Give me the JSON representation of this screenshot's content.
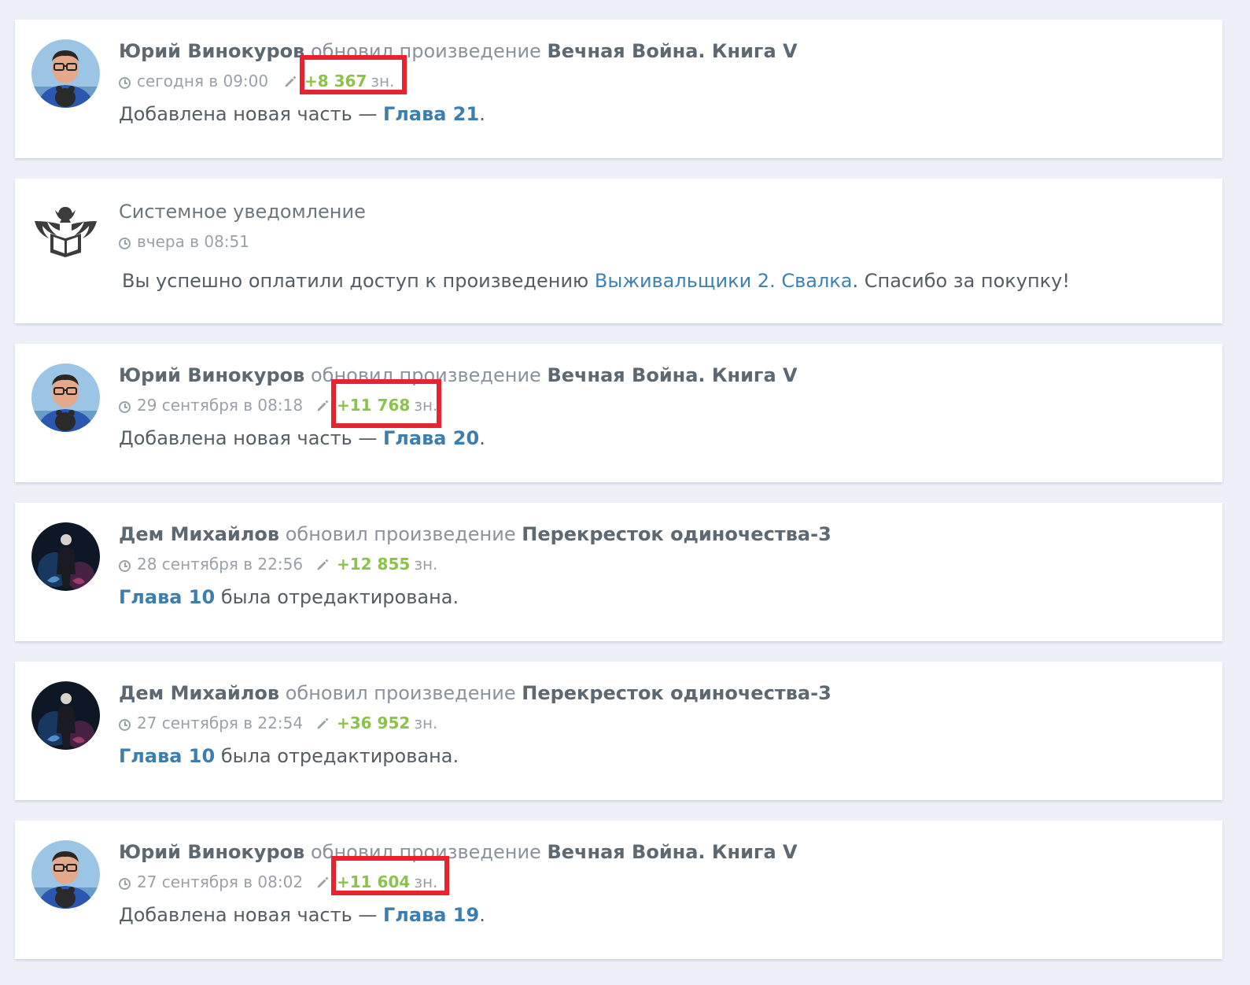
{
  "feed": {
    "items": [
      {
        "author": "Юрий Винокуров",
        "action": "обновил произведение",
        "work": "Вечная Война. Книга V",
        "time": "сегодня в 09:00",
        "count": "+8 367",
        "unit": "зн.",
        "text_before": "Добавлена новая часть —",
        "link": "Глава 21",
        "text_after": "."
      },
      {
        "title": "Системное уведомление",
        "time": "вчера в 08:51",
        "text_before": "Вы успешно оплатили доступ к произведению",
        "link": "Выживальщики 2. Свалка",
        "text_after": ". Спасибо за покупку!"
      },
      {
        "author": "Юрий Винокуров",
        "action": "обновил произведение",
        "work": "Вечная Война. Книга V",
        "time": "29 сентября в 08:18",
        "count": "+11 768",
        "unit": "зн.",
        "text_before": "Добавлена новая часть —",
        "link": "Глава 20",
        "text_after": "."
      },
      {
        "author": "Дем Михайлов",
        "action": "обновил произведение",
        "work": "Перекресток одиночества-3",
        "time": "28 сентября в 22:56",
        "count": "+12 855",
        "unit": "зн.",
        "link": "Глава 10",
        "text_after": "была отредактирована."
      },
      {
        "author": "Дем Михайлов",
        "action": "обновил произведение",
        "work": "Перекресток одиночества-3",
        "time": "27 сентября в 22:54",
        "count": "+36 952",
        "unit": "зн.",
        "link": "Глава 10",
        "text_after": "была отредактирована."
      },
      {
        "author": "Юрий Винокуров",
        "action": "обновил произведение",
        "work": "Вечная Война. Книга V",
        "time": "27 сентября в 08:02",
        "count": "+11 604",
        "unit": "зн.",
        "text_before": "Добавлена новая часть —",
        "link": "Глава 19",
        "text_after": "."
      }
    ]
  },
  "colors": {
    "page_background": "#edf0f7",
    "count_green": "#8bc34a",
    "link_blue": "#3d7eb0",
    "highlight_red": "#e8222e"
  }
}
